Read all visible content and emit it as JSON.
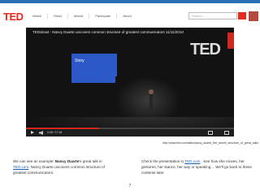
{
  "header": {
    "logo": "TED",
    "nav": [
      "Watch",
      "Read",
      "Attend",
      "Participate",
      "About"
    ],
    "search_placeholder": "Search..."
  },
  "video": {
    "title": "TEDxEast - Nancy Duarte uncovers common structure of greatest communicators 11/11/2010",
    "slide_text": "Story",
    "stage_logo": "TED",
    "progress_fraction": 0.35,
    "time_label": "0:48 / 17:44"
  },
  "caption_url": "http://www.ted.com/talks/nancy_duarte_the_secret_structure_of_great_talks",
  "left_paragraph": {
    "prefix": "We can see an example: ",
    "bold": "Nancy Duarte",
    "mid": "'s great talk in ",
    "link": "TED.com",
    "suffix": ". Nancy Duarte uncovers common structure of greatest communicators."
  },
  "right_paragraph": {
    "prefix": "Check the presentation in ",
    "link": "TED.com",
    "suffix": " . See how she moves, her gestures, her stance, her way or speaking… We'll go back to these contents later."
  },
  "page_number": "7",
  "colors": {
    "ted_red": "#e62b1e",
    "link_blue": "#1a5fb4",
    "top_bar": "#2a6fb3",
    "slide_blue": "#2d58c8"
  }
}
